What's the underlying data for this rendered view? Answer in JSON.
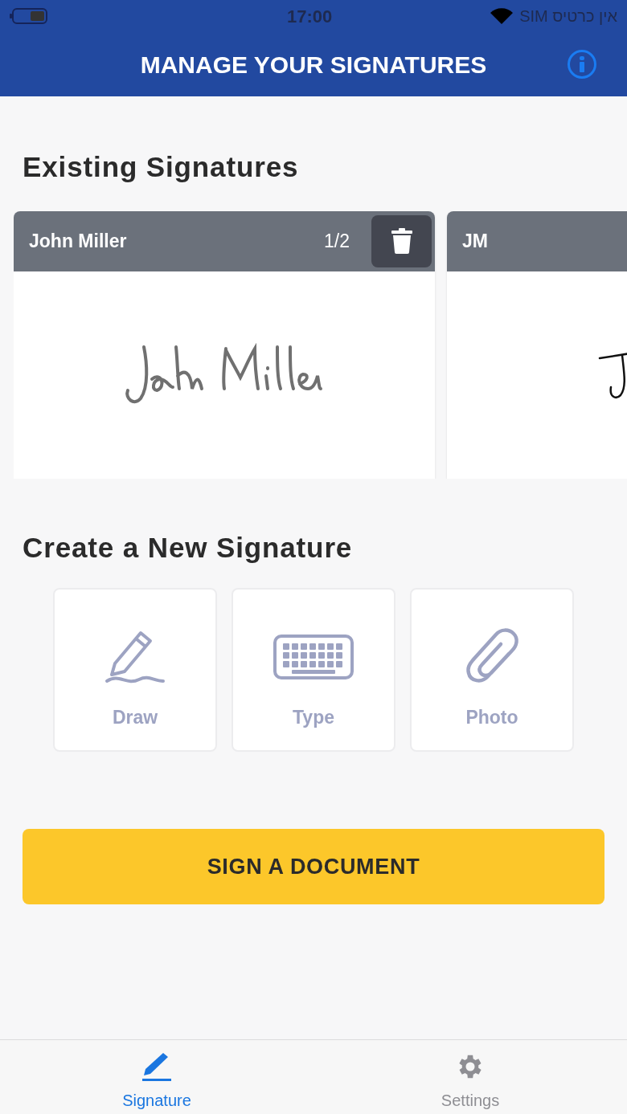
{
  "status_bar": {
    "time": "17:00",
    "carrier": "אין כרטיס SIM"
  },
  "nav": {
    "title": "MANAGE YOUR SIGNATURES"
  },
  "existing": {
    "heading": "Existing Signatures",
    "cards": [
      {
        "name": "John Miller",
        "counter": "1/2",
        "kind": "wide"
      },
      {
        "name": "JM",
        "kind": "short"
      }
    ]
  },
  "create": {
    "heading": "Create a New Signature",
    "options": [
      {
        "kind": "draw",
        "label": "Draw"
      },
      {
        "kind": "type",
        "label": "Type"
      },
      {
        "label": "Photo"
      }
    ]
  },
  "primary_button": "SIGN A DOCUMENT",
  "tabs": [
    {
      "label": "Signature",
      "kind": "signature",
      "selected": true
    },
    {
      "label": "Settings",
      "kind": "settings",
      "selected": false
    }
  ]
}
